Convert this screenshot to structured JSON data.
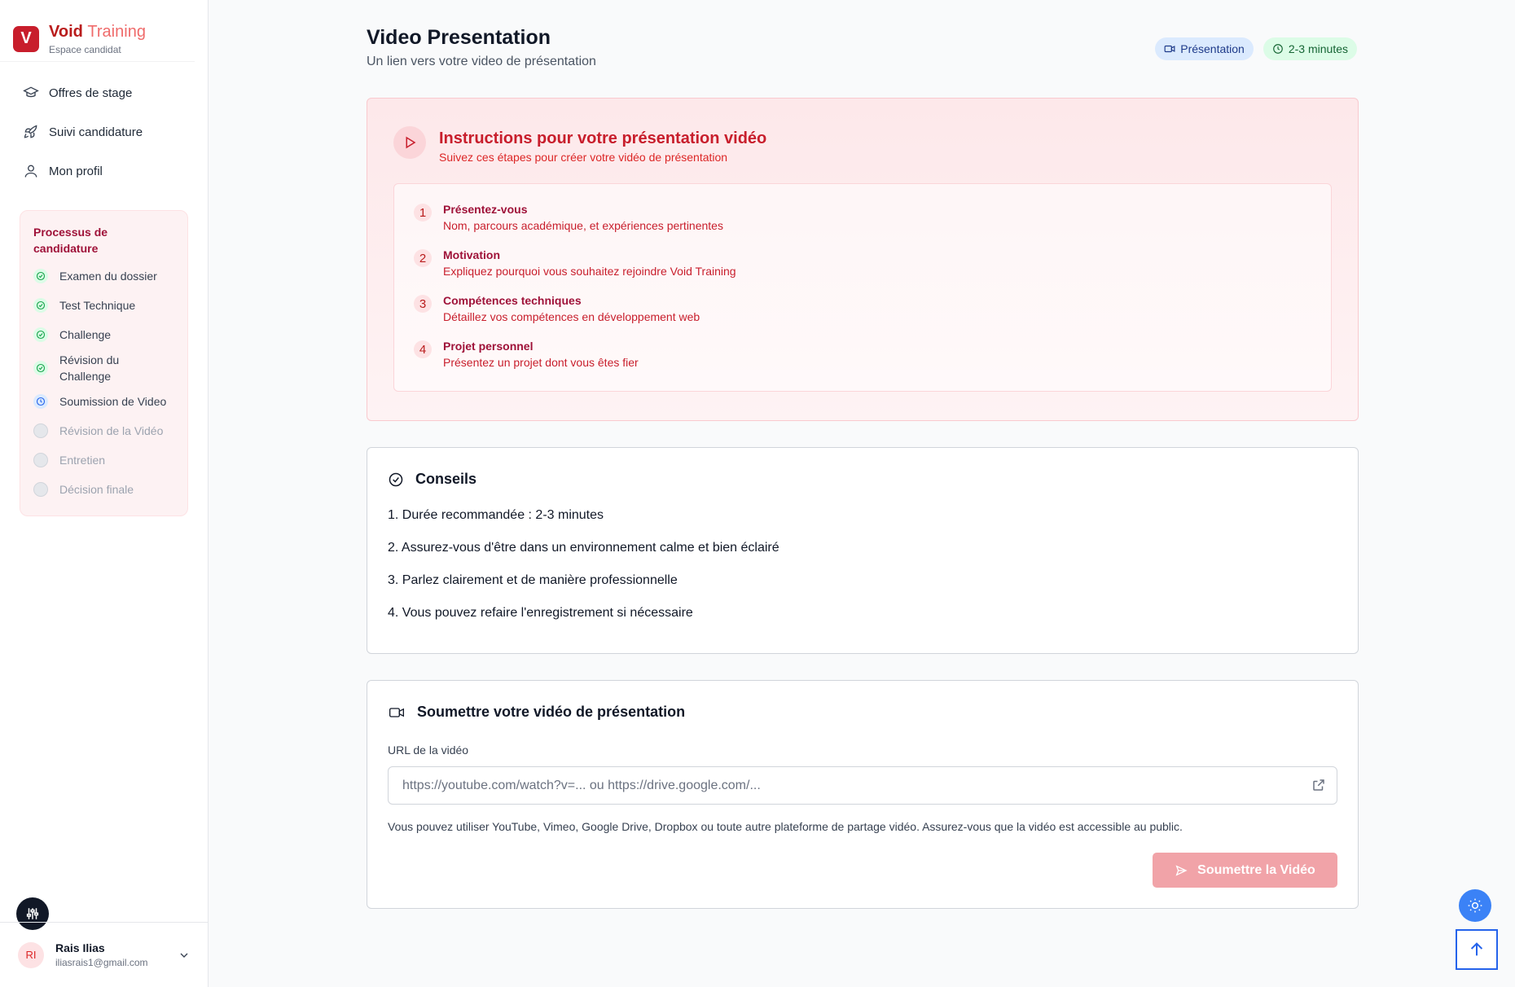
{
  "brand": {
    "logo_letter": "V",
    "name_main": "Void",
    "name_accent": "Training",
    "subtitle": "Espace candidat"
  },
  "nav": [
    {
      "label": "Offres de stage",
      "icon": "graduation-cap-icon"
    },
    {
      "label": "Suivi candidature",
      "icon": "rocket-icon"
    },
    {
      "label": "Mon profil",
      "icon": "user-icon"
    }
  ],
  "process": {
    "title": "Processus de candidature",
    "steps": [
      {
        "label": "Examen du dossier",
        "status": "done"
      },
      {
        "label": "Test Technique",
        "status": "done"
      },
      {
        "label": "Challenge",
        "status": "done"
      },
      {
        "label": "Révision du Challenge",
        "status": "done"
      },
      {
        "label": "Soumission de Video",
        "status": "current"
      },
      {
        "label": "Révision de la Vidéo",
        "status": "pending"
      },
      {
        "label": "Entretien",
        "status": "pending"
      },
      {
        "label": "Décision finale",
        "status": "pending"
      }
    ]
  },
  "user": {
    "initials": "RI",
    "name": "Rais Ilias",
    "email": "iliasrais1@gmail.com"
  },
  "header": {
    "title": "Video Presentation",
    "subtitle": "Un lien vers votre video de présentation",
    "badge_type": "Présentation",
    "badge_duration": "2-3 minutes"
  },
  "instructions": {
    "title": "Instructions pour votre présentation vidéo",
    "subtitle": "Suivez ces étapes pour créer votre vidéo de présentation",
    "items": [
      {
        "num": "1",
        "title": "Présentez-vous",
        "desc": "Nom, parcours académique, et expériences pertinentes"
      },
      {
        "num": "2",
        "title": "Motivation",
        "desc": "Expliquez pourquoi vous souhaitez rejoindre Void Training"
      },
      {
        "num": "3",
        "title": "Compétences techniques",
        "desc": "Détaillez vos compétences en développement web"
      },
      {
        "num": "4",
        "title": "Projet personnel",
        "desc": "Présentez un projet dont vous êtes fier"
      }
    ]
  },
  "tips": {
    "title": "Conseils",
    "items": [
      "1. Durée recommandée : 2-3 minutes",
      "2. Assurez-vous d'être dans un environnement calme et bien éclairé",
      "3. Parlez clairement et de manière professionnelle",
      "4. Vous pouvez refaire l'enregistrement si nécessaire"
    ]
  },
  "submit": {
    "title": "Soumettre votre vidéo de présentation",
    "field_label": "URL de la vidéo",
    "value": "",
    "placeholder": "https://youtube.com/watch?v=... ou https://drive.google.com/...",
    "help": "Vous pouvez utiliser YouTube, Vimeo, Google Drive, Dropbox ou toute autre plateforme de partage vidéo. Assurez-vous que la vidéo est accessible au public.",
    "button": "Soumettre la Vidéo"
  },
  "colors": {
    "brand": "#c81e2c",
    "accent_blue": "#3b82f6",
    "success": "#16a34a"
  }
}
